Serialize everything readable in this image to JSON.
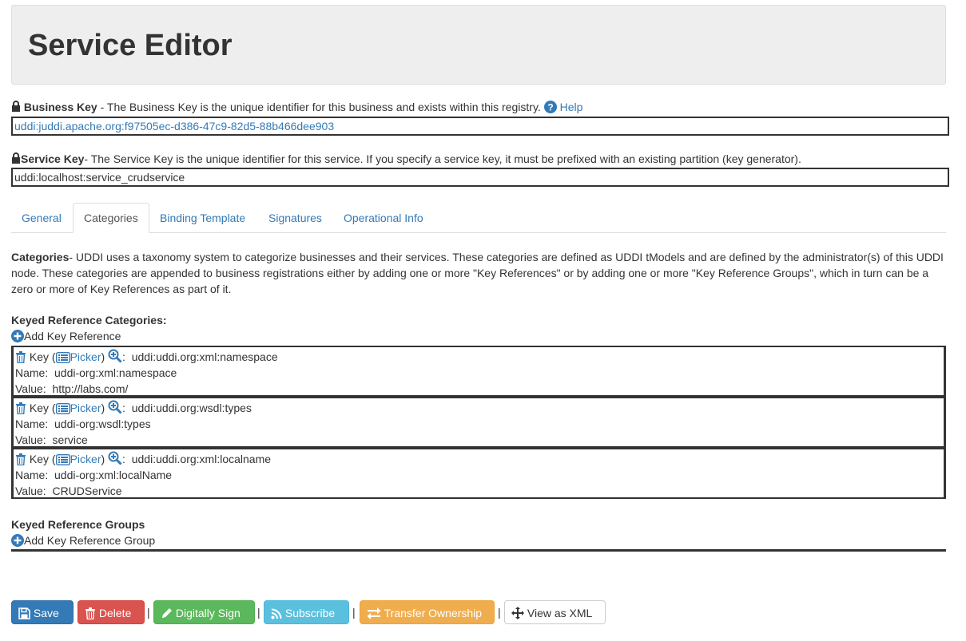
{
  "page": {
    "title": "Service Editor"
  },
  "business_key": {
    "label": "Business Key",
    "description": " - The Business Key is the unique identifier for this business and exists within this registry.",
    "help_label": "Help",
    "value": "uddi:juddi.apache.org:f97505ec-d386-47c9-82d5-88b466dee903"
  },
  "service_key": {
    "label": "Service Key",
    "description": "- The Service Key is the unique identifier for this service. If you specify a service key, it must be prefixed with an existing partition (key generator).",
    "value": "uddi:localhost:service_crudservice"
  },
  "tabs": [
    {
      "label": "General",
      "active": false
    },
    {
      "label": "Categories",
      "active": true
    },
    {
      "label": "Binding Template",
      "active": false
    },
    {
      "label": "Signatures",
      "active": false
    },
    {
      "label": "Operational Info",
      "active": false
    }
  ],
  "categories": {
    "heading": "Categories",
    "description": "- UDDI uses a taxonomy system to categorize businesses and their services. These categories are defined as UDDI tModels and are defined by the administrator(s) of this UDDI node. These categories are appended to business registrations either by adding one or more \"Key References\" or by adding one or more \"Key Reference Groups\", which in turn can be a zero or more of Key References as part of it.",
    "keyed_heading": "Keyed Reference Categories:",
    "add_key_reference": "Add Key Reference",
    "key_prefix": "Key (",
    "picker_label": "Picker",
    "key_suffix": ")",
    "name_label": "Name:",
    "value_label": "Value:",
    "references": [
      {
        "key": "uddi:uddi.org:xml:namespace",
        "name": "uddi-org:xml:namespace",
        "value": "http://labs.com/"
      },
      {
        "key": "uddi:uddi.org:wsdl:types",
        "name": "uddi-org:wsdl:types",
        "value": "service"
      },
      {
        "key": "uddi:uddi.org:xml:localname",
        "name": "uddi-org:xml:localName",
        "value": "CRUDService"
      }
    ],
    "groups_heading": "Keyed Reference Groups",
    "add_group": "Add Key Reference Group"
  },
  "actions": {
    "save": "Save",
    "delete": "Delete",
    "sign": "Digitally Sign",
    "subscribe": "Subscribe",
    "transfer": "Transfer Ownership",
    "view_xml": "View as XML",
    "separator": "|"
  },
  "colors": {
    "link": "#337ab7",
    "primary": "#337ab7",
    "danger": "#d9534f",
    "success": "#5cb85c",
    "info": "#5bc0de",
    "warning": "#f0ad4e"
  }
}
